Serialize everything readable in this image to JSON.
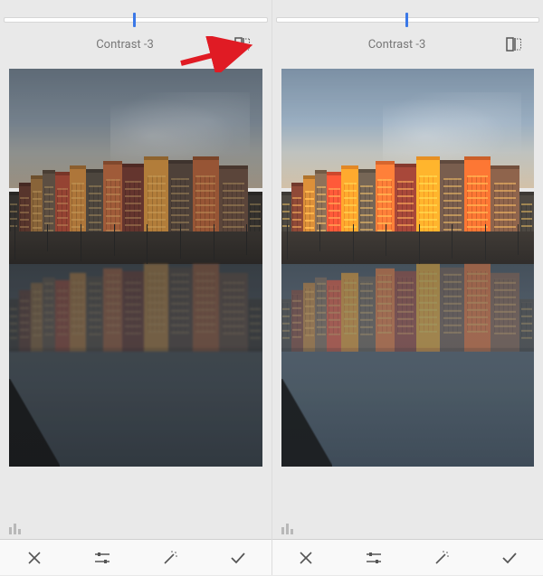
{
  "slider": {
    "label": "Contrast -3",
    "positionPercent": 49
  },
  "icons": {
    "compare": "compare",
    "histogram": "histogram",
    "cancel": "cancel",
    "tune": "tune",
    "magic": "auto-fix",
    "apply": "apply"
  },
  "annotation": {
    "showArrow": true
  }
}
